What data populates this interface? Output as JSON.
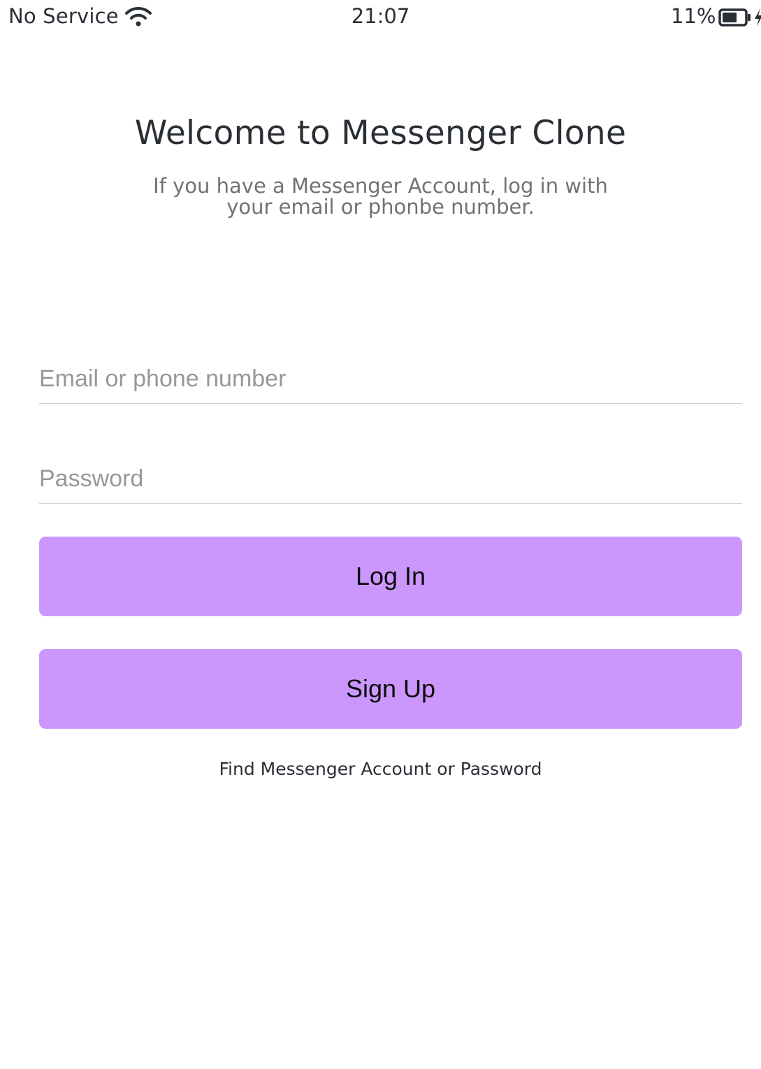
{
  "status_bar": {
    "carrier": "No Service",
    "time": "21:07",
    "battery_percent": "11%",
    "battery_level": 0.11,
    "icons": [
      "wifi-icon",
      "battery-icon",
      "charging-bolt-icon"
    ]
  },
  "header": {
    "title": "Welcome to Messenger Clone",
    "subtitle": "If you have a Messenger Account, log in with your email or phonbe number."
  },
  "form": {
    "email_placeholder": "Email or phone number",
    "email_value": "",
    "password_placeholder": "Password",
    "password_value": "",
    "login_label": "Log In",
    "signup_label": "Sign Up",
    "find_account_link": "Find Messenger Account or Password"
  },
  "colors": {
    "button_background": "#cc97fd",
    "button_text": "#0b0b0b",
    "title_text": "#2a2f36",
    "subtitle_text": "#6f7378",
    "placeholder_text": "#95989c",
    "field_underline": "#cfd1d4"
  }
}
